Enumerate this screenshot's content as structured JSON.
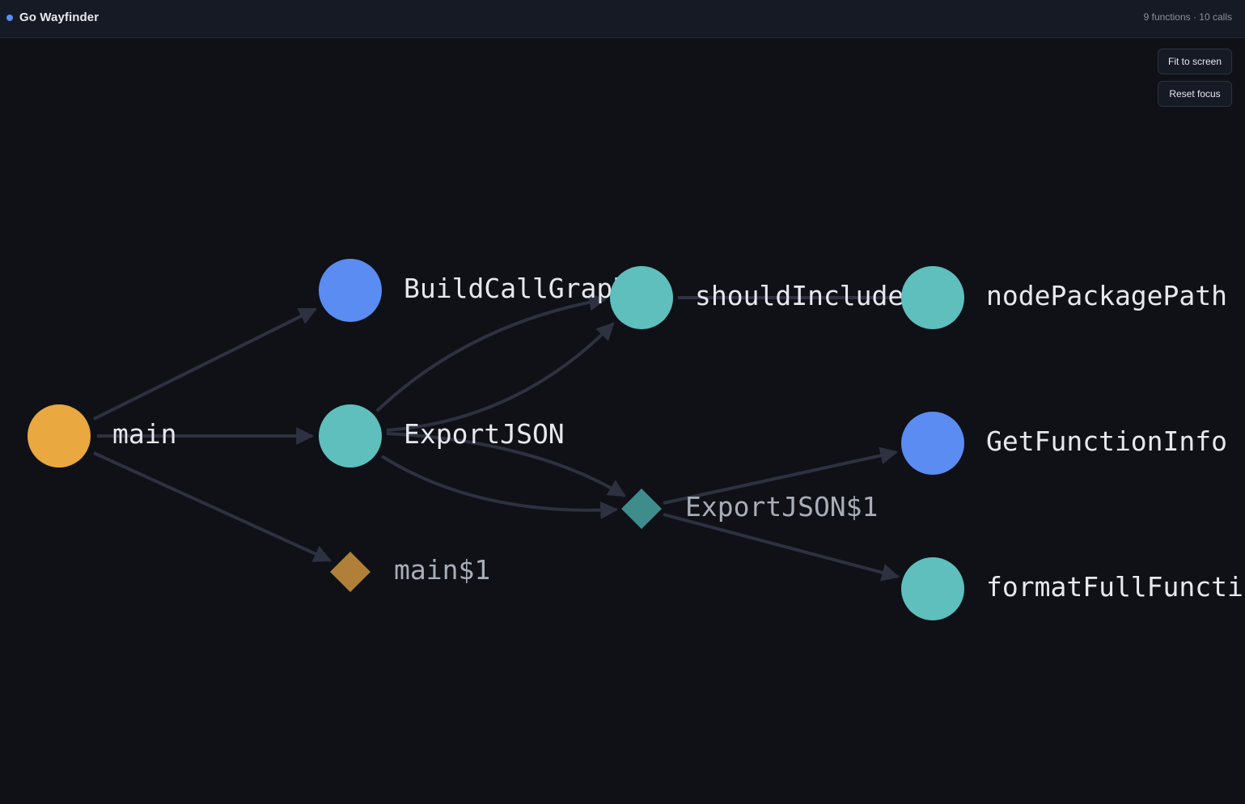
{
  "app": {
    "title": "Go Wayfinder",
    "status_dot_color": "#5b8def"
  },
  "header": {
    "stats": "9 functions · 10 calls"
  },
  "controls": {
    "fit_label": "Fit to screen",
    "reset_label": "Reset focus"
  },
  "colors": {
    "entry": "#e9a840",
    "exported": "#5b8cf2",
    "internal": "#5ebfbd",
    "anon_entry": "#b07f38",
    "anon_internal": "#3f8c8c",
    "edge": "#2e3140"
  },
  "graph": {
    "nodes": [
      {
        "id": "main",
        "label": "main",
        "shape": "circle",
        "kind": "entry"
      },
      {
        "id": "BuildCallGraph",
        "label": "BuildCallGraph",
        "shape": "circle",
        "kind": "exported"
      },
      {
        "id": "ExportJSON",
        "label": "ExportJSON",
        "shape": "circle",
        "kind": "internal"
      },
      {
        "id": "main$1",
        "label": "main$1",
        "shape": "diamond",
        "kind": "anon_entry"
      },
      {
        "id": "shouldInclude",
        "label": "shouldInclude",
        "shape": "circle",
        "kind": "internal"
      },
      {
        "id": "ExportJSON$1",
        "label": "ExportJSON$1",
        "shape": "diamond",
        "kind": "anon_internal"
      },
      {
        "id": "nodePackagePath",
        "label": "nodePackagePath",
        "shape": "circle",
        "kind": "internal"
      },
      {
        "id": "GetFunctionInfo",
        "label": "GetFunctionInfo",
        "shape": "circle",
        "kind": "exported"
      },
      {
        "id": "formatFullFunctionName",
        "label": "formatFullFunctionName",
        "shape": "circle",
        "kind": "internal"
      }
    ],
    "edges": [
      {
        "from": "main",
        "to": "BuildCallGraph"
      },
      {
        "from": "main",
        "to": "ExportJSON"
      },
      {
        "from": "main",
        "to": "main$1"
      },
      {
        "from": "ExportJSON",
        "to": "shouldInclude"
      },
      {
        "from": "ExportJSON",
        "to": "shouldInclude"
      },
      {
        "from": "ExportJSON",
        "to": "ExportJSON$1"
      },
      {
        "from": "ExportJSON",
        "to": "ExportJSON$1"
      },
      {
        "from": "shouldInclude",
        "to": "nodePackagePath"
      },
      {
        "from": "ExportJSON$1",
        "to": "GetFunctionInfo"
      },
      {
        "from": "ExportJSON$1",
        "to": "formatFullFunctionName"
      }
    ]
  }
}
